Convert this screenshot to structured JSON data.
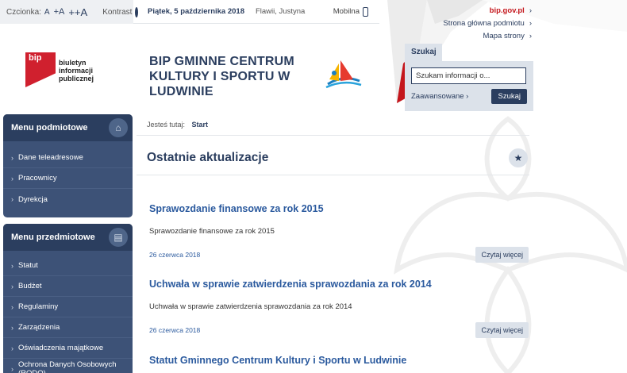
{
  "accessibility": {
    "font_label": "Czcionka:",
    "font_a_small": "A",
    "font_a_mid": "+A",
    "font_a_big": "++A",
    "contrast_label": "Kontrast"
  },
  "topbar": {
    "date": "Piątek, 5 października 2018",
    "users": "Flawii, Justyna",
    "mobile": "Mobilna"
  },
  "logo": {
    "bip_mark": "bip",
    "line1": "biuletyn",
    "line2": "informacji publicznej"
  },
  "institution": {
    "title": "BIP GMINNE CENTRUM KULTURY I SPORTU W LUDWINIE"
  },
  "top_links": {
    "bip_gov": "bip.gov.pl",
    "home": "Strona główna podmiotu",
    "sitemap": "Mapa strony"
  },
  "search": {
    "tab": "Szukaj",
    "placeholder": "Szukam informacji o...",
    "advanced": "Zaawansowane",
    "button": "Szukaj"
  },
  "menu_subject": {
    "title": "Menu podmiotowe",
    "items": [
      "Dane teleadresowe",
      "Pracownicy",
      "Dyrekcja"
    ]
  },
  "menu_object": {
    "title": "Menu przedmiotowe",
    "items": [
      "Statut",
      "Budżet",
      "Regulaminy",
      "Zarządzenia",
      "Oświadczenia majątkowe",
      "Ochrona Danych Osobowych (RODO)"
    ]
  },
  "breadcrumb": {
    "label": "Jesteś tutaj:",
    "current": "Start"
  },
  "main": {
    "title": "Ostatnie aktualizacje",
    "entries": [
      {
        "title": "Sprawozdanie finansowe za rok 2015",
        "desc": "Sprawozdanie finansowe za rok 2015",
        "date": "26 czerwca 2018",
        "more": "Czytaj więcej"
      },
      {
        "title": "Uchwała w sprawie zatwierdzenia sprawozdania za rok 2014",
        "desc": "Uchwała w sprawie zatwierdzenia sprawozdania za rok 2014",
        "date": "26 czerwca 2018",
        "more": "Czytaj więcej"
      },
      {
        "title": "Statut Gminnego Centrum Kultury i Sportu w Ludwinie"
      }
    ]
  },
  "colors": {
    "navy": "#2b3e5f",
    "menu_bg": "#3d5277",
    "link_blue": "#2b5a9e",
    "bip_red": "#d0202e"
  }
}
